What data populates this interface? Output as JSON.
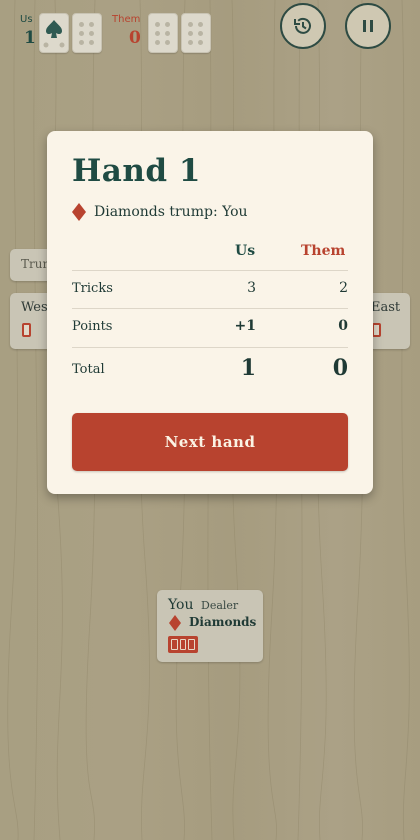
{
  "scoreboard": {
    "us_label": "Us",
    "us_score": "1",
    "them_label": "Them",
    "them_score": "0"
  },
  "controls": {
    "history_icon": "history-icon",
    "pause_icon": "pause-icon"
  },
  "seats": {
    "north_label": "Trump",
    "west_label": "West",
    "east_label": "East",
    "you_label": "You",
    "you_role": "Dealer",
    "you_suit": "Diamonds"
  },
  "modal": {
    "title": "Hand 1",
    "trump_text": "Diamonds trump: You",
    "col_us": "Us",
    "col_them": "Them",
    "rows": [
      {
        "label": "Tricks",
        "us": "3",
        "them": "2"
      },
      {
        "label": "Points",
        "us": "+1",
        "them": "0"
      },
      {
        "label": "Total",
        "us": "1",
        "them": "0"
      }
    ],
    "next_button": "Next hand"
  },
  "colors": {
    "green": "#1f4b43",
    "red": "#b8432f",
    "panel": "#faf4e8"
  }
}
